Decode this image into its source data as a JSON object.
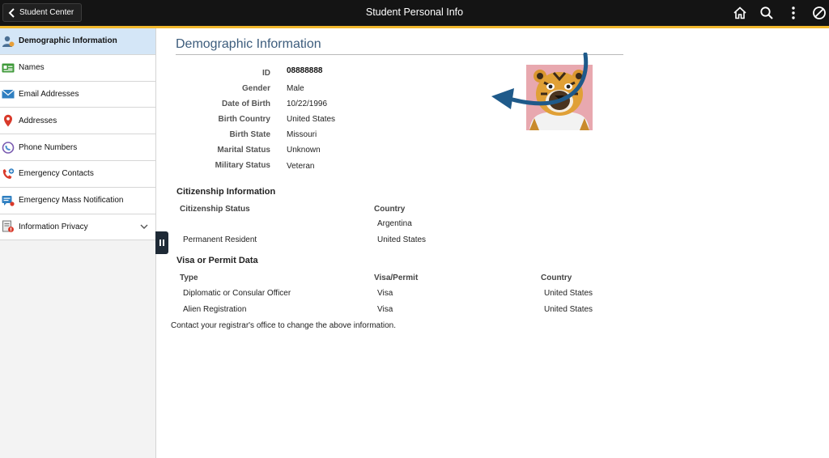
{
  "header": {
    "back_label": "Student Center",
    "title": "Student Personal Info",
    "icons": [
      "home-icon",
      "search-icon",
      "more-vertical-icon",
      "no-symbol-icon"
    ],
    "accent_color": "#f1b82d"
  },
  "sidebar": {
    "items": [
      {
        "label": "Demographic Information",
        "icon": "person-icon",
        "active": true
      },
      {
        "label": "Names",
        "icon": "id-card-icon"
      },
      {
        "label": "Email Addresses",
        "icon": "envelope-icon"
      },
      {
        "label": "Addresses",
        "icon": "map-pin-icon"
      },
      {
        "label": "Phone Numbers",
        "icon": "phone-icon"
      },
      {
        "label": "Emergency Contacts",
        "icon": "emergency-phone-icon"
      },
      {
        "label": "Emergency Mass Notification",
        "icon": "chat-icon"
      },
      {
        "label": "Information Privacy",
        "icon": "privacy-doc-icon",
        "expandable": true
      }
    ]
  },
  "main": {
    "title": "Demographic Information",
    "fields": [
      {
        "label": "ID",
        "value": "08888888"
      },
      {
        "label": "Gender",
        "value": "Male"
      },
      {
        "label": "Date of Birth",
        "value": "10/22/1996"
      },
      {
        "label": "Birth Country",
        "value": "United States"
      },
      {
        "label": "Birth State",
        "value": "Missouri"
      },
      {
        "label": "Marital Status",
        "value": "Unknown"
      },
      {
        "label": "Military Status",
        "value": "Veteran"
      }
    ],
    "citizenship": {
      "title": "Citizenship Information",
      "headers": [
        "Citizenship Status",
        "Country"
      ],
      "rows": [
        [
          "",
          "Argentina"
        ],
        [
          "Permanent Resident",
          "United States"
        ]
      ]
    },
    "visa": {
      "title": "Visa or Permit Data",
      "headers": [
        "Type",
        "Visa/Permit",
        "Country"
      ],
      "rows": [
        [
          "Diplomatic or Consular Officer",
          "Visa",
          "United States"
        ],
        [
          "Alien Registration",
          "Visa",
          "United States"
        ]
      ]
    },
    "note": "Contact your registrar's office to change the above information."
  }
}
